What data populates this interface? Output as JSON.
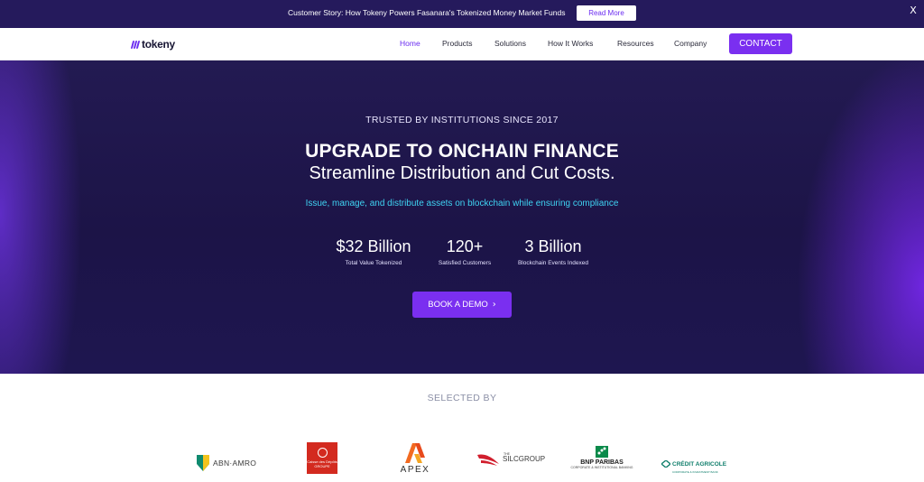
{
  "announcement": {
    "text": "Customer Story: How Tokeny Powers Fasanara's Tokenized Money Market Funds",
    "button_label": "Read More",
    "close_label": "X"
  },
  "nav": {
    "logo_text": "tokeny",
    "items": [
      {
        "label": "Home",
        "active": true
      },
      {
        "label": "Products"
      },
      {
        "label": "Solutions"
      },
      {
        "label": "How It Works"
      },
      {
        "label": "Resources"
      },
      {
        "label": "Company"
      }
    ],
    "contact_label": "CONTACT"
  },
  "hero": {
    "eyebrow": "TRUSTED BY INSTITUTIONS SINCE 2017",
    "title": "UPGRADE TO ONCHAIN FINANCE",
    "subtitle": "Streamline Distribution and Cut Costs.",
    "tagline": "Issue, manage, and distribute assets on blockchain while ensuring compliance",
    "stats": [
      {
        "value": "$32 Billion",
        "label": "Total Value Tokenized"
      },
      {
        "value": "120+",
        "label": "Satisfied Customers"
      },
      {
        "value": "3 Billion",
        "label": "Blockchain Events Indexed"
      }
    ],
    "cta_label": "BOOK A DEMO"
  },
  "clients": {
    "title": "SELECTED BY",
    "logos": [
      {
        "name": "ABN·AMRO"
      },
      {
        "name": "Caisse des Dépôts GROUPE"
      },
      {
        "name": "APEX"
      },
      {
        "name": "SILCGROUP",
        "prefix": "THE"
      },
      {
        "name": "BNP PARIBAS",
        "sub": "CORPORATE & INSTITUTIONAL BANKING"
      },
      {
        "name": "CRÉDIT AGRICOLE",
        "sub": "CORPORATE & INVESTMENT BANK"
      }
    ]
  },
  "colors": {
    "accent": "#7a2ff0",
    "hero_bg": "#1c1447",
    "announce_bg": "#251a5c",
    "tagline": "#3fd3f2"
  }
}
